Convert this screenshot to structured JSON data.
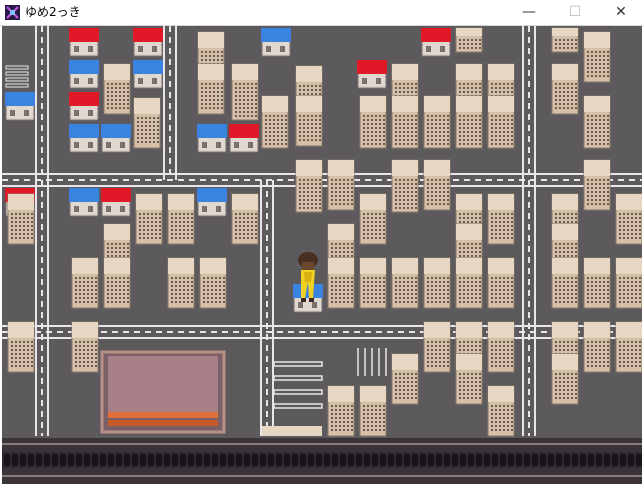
{
  "window": {
    "title": "ゆめ2っき",
    "minimize_glyph": "—",
    "maximize_glyph": "☐",
    "close_glyph": "✕"
  },
  "scene": {
    "background_color": "#5d5a5e",
    "road_line_color": "#e8e6e8",
    "building_color": "#d4c0a8",
    "roof_red": "#e01828",
    "roof_blue": "#3a84e0",
    "pond_color": "#a88088",
    "rail_color": "#302830"
  },
  "icons": {
    "app": "game-app-icon",
    "player": "player-character-icon"
  }
}
